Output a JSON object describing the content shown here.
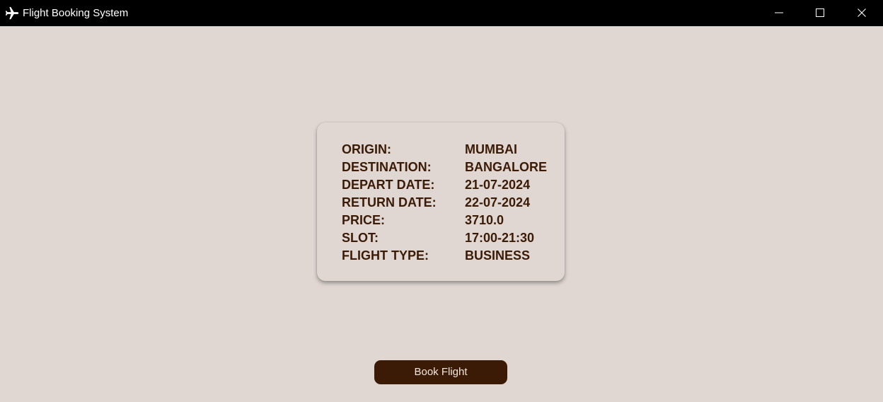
{
  "window": {
    "title": "Flight Booking System",
    "app_icon": "airplane-icon",
    "controls": {
      "minimize_icon": "minimize-icon",
      "maximize_icon": "maximize-icon",
      "close_icon": "close-icon"
    }
  },
  "booking_details": {
    "rows": [
      {
        "label": "ORIGIN:",
        "value": "MUMBAI"
      },
      {
        "label": "DESTINATION:",
        "value": "BANGALORE"
      },
      {
        "label": "DEPART DATE:",
        "value": "21-07-2024"
      },
      {
        "label": "RETURN DATE:",
        "value": "22-07-2024"
      },
      {
        "label": "PRICE:",
        "value": "3710.0"
      },
      {
        "label": "SLOT:",
        "value": "17:00-21:30"
      },
      {
        "label": "FLIGHT TYPE:",
        "value": "BUSINESS"
      }
    ]
  },
  "actions": {
    "book_label": "Book Flight"
  },
  "colors": {
    "background": "#e0d7d2",
    "accent_text": "#3b1b06",
    "button_bg": "#3b1b06",
    "button_text": "#f2e6dc",
    "titlebar": "#000000"
  }
}
